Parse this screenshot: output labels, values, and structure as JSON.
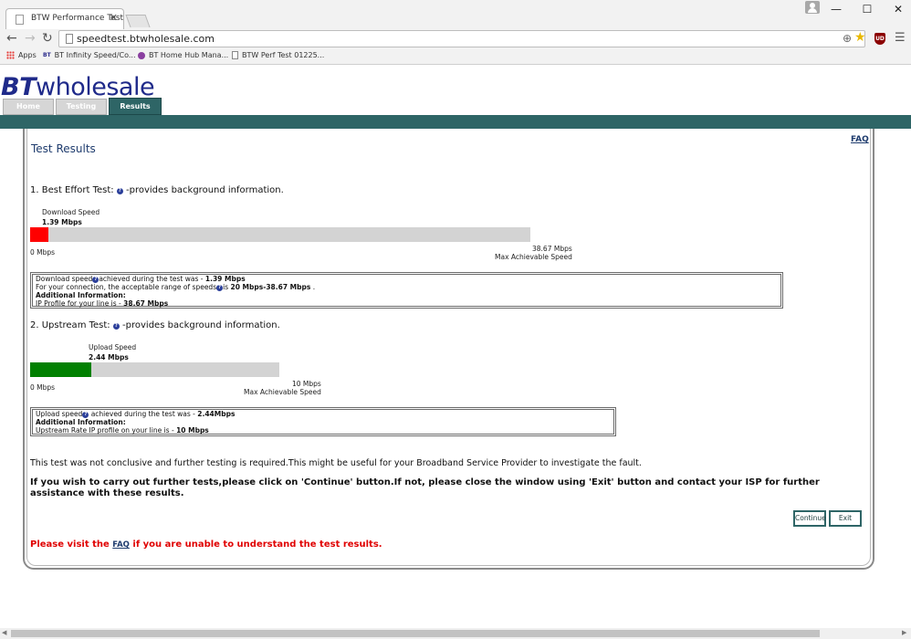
{
  "browser": {
    "tab_title": "BTW Performance Test",
    "tab_close": "✕",
    "url": "speedtest.btwholesale.com",
    "window_controls": [
      "—",
      "☐",
      "✕"
    ],
    "bookmarks": [
      "Apps",
      "BT Infinity Speed/Co...",
      "BT Home Hub Mana...",
      "BTW Perf Test 01225..."
    ],
    "ext_label": "UD"
  },
  "site": {
    "logo_bt": "BT",
    "logo_rest": "wholesale",
    "nav_tabs": [
      "Home",
      "Testing",
      "Results"
    ],
    "active_tab": "Results"
  },
  "results": {
    "faq_link": "FAQ",
    "title": "Test Results",
    "best_effort": {
      "heading_prefix": "1. Best Effort Test:",
      "heading_suffix": "-provides background information.",
      "speed_label": "Download Speed",
      "speed_value": "1.39 Mbps",
      "min_label": "0 Mbps",
      "max_value": "38.67 Mbps",
      "max_label": "Max Achievable Speed",
      "speed_mbps": 1.39,
      "max_mbps": 38.67,
      "bar_color": "#ff0000",
      "info": {
        "line1_prefix": "Download speed",
        "line1_mid": "achieved during the test was - ",
        "line1_value": "1.39 Mbps",
        "line2_prefix": "For your connection, the acceptable range of speeds",
        "line2_mid": "is ",
        "line2_value": "20 Mbps-38.67 Mbps",
        "line2_suffix": " .",
        "line3": "Additional Information:",
        "line4_prefix": "IP Profile for your line is - ",
        "line4_value": "38.67 Mbps"
      }
    },
    "upstream": {
      "heading_prefix": "2. Upstream Test:",
      "heading_suffix": "-provides background information.",
      "speed_label": "Upload Speed",
      "speed_value": "2.44 Mbps",
      "min_label": "0 Mbps",
      "max_value": "10 Mbps",
      "max_label": "Max Achievable Speed",
      "speed_mbps": 2.44,
      "max_mbps": 10,
      "bar_color": "#008000",
      "info": {
        "line1_prefix": "Upload speed",
        "line1_mid": " achieved during the test was - ",
        "line1_value": "2.44Mbps",
        "line2": "Additional Information:",
        "line3_prefix": "Upstream Rate IP profile on your line is - ",
        "line3_value": "10 Mbps"
      }
    },
    "status_message": "This test was not conclusive and further testing is required.This might be useful for your Broadband Service Provider to investigate the fault.",
    "instructions": "If you wish to carry out further tests,please click on 'Continue' button.If not, please close the window using 'Exit' button and contact your ISP for further assistance with these results.",
    "continue_label": "Continue",
    "exit_label": "Exit",
    "visit_prefix": "Please visit the ",
    "visit_link": "FAQ",
    "visit_suffix": " if you are unable to understand the test results."
  },
  "colors": {
    "brand_navy": "#1f2a8a",
    "brand_teal": "#2e6566",
    "alert_red": "#e00000"
  }
}
